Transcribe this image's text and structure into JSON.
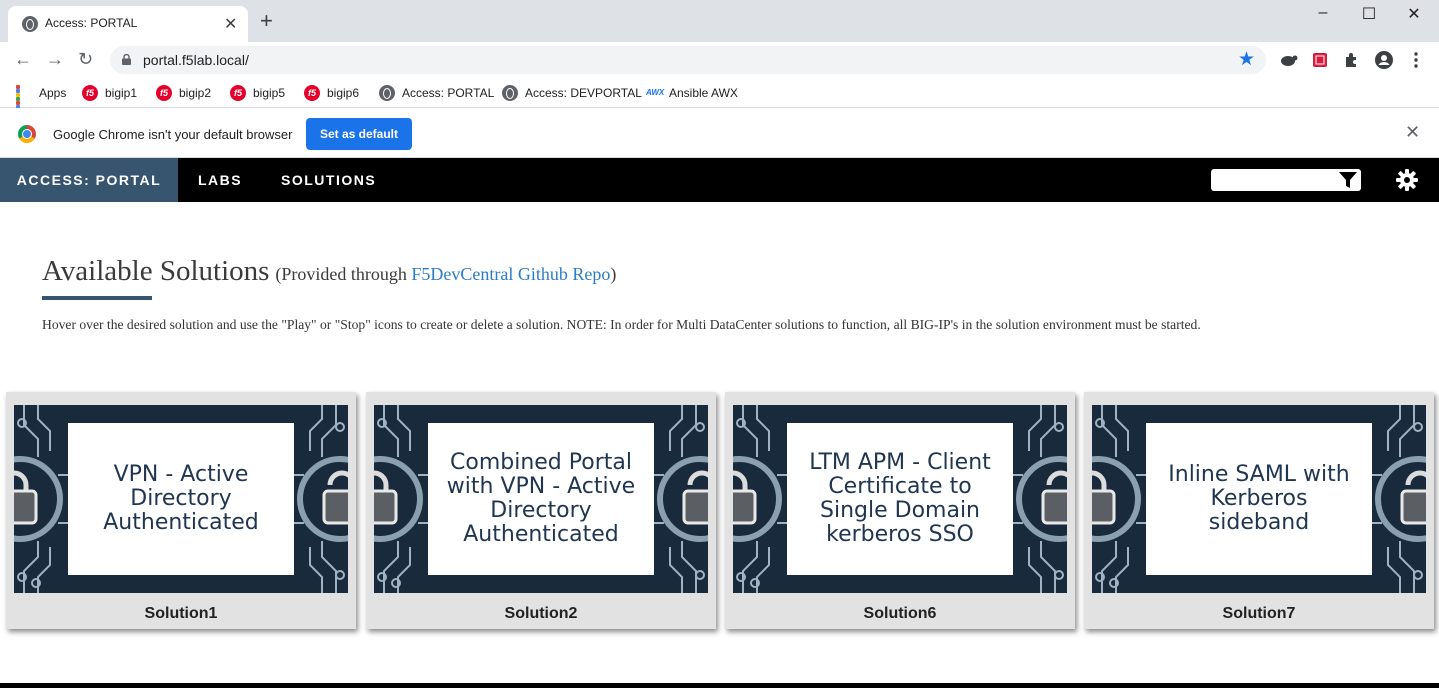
{
  "browser": {
    "tab_title": "Access: PORTAL",
    "url": "portal.f5lab.local/",
    "bookmarks": [
      {
        "label": "Apps",
        "icon": "apps-grid-icon"
      },
      {
        "label": "bigip1",
        "icon": "f5-logo-icon"
      },
      {
        "label": "bigip2",
        "icon": "f5-logo-icon"
      },
      {
        "label": "bigip5",
        "icon": "f5-logo-icon"
      },
      {
        "label": "bigip6",
        "icon": "f5-logo-icon"
      },
      {
        "label": "Access: PORTAL",
        "icon": "globe-icon"
      },
      {
        "label": "Access: DEVPORTAL",
        "icon": "globe-icon"
      },
      {
        "label": "Ansible AWX",
        "icon": "awx-icon"
      }
    ],
    "infobar": {
      "message": "Google Chrome isn't your default browser",
      "button_label": "Set as default"
    },
    "window_controls": {
      "minimize": "–",
      "maximize": "☐",
      "close": "✕"
    },
    "new_tab": "+",
    "tab_close": "✕",
    "infobar_close": "✕",
    "bookmark_star": "★",
    "accent_color": "#1a73e8"
  },
  "app": {
    "nav": {
      "brand": "ACCESS: PORTAL",
      "links": [
        "LABS",
        "SOLUTIONS"
      ],
      "search_placeholder": "",
      "brand_color": "#385570"
    },
    "page": {
      "heading": "Available Solutions",
      "subheading_prefix": "(Provided through ",
      "subheading_link": "F5DevCentral Github Repo",
      "subheading_suffix": ")",
      "instructions": "Hover over the desired solution and use the \"Play\" or \"Stop\" icons to create or delete a solution. NOTE: In order for Multi DataCenter solutions to function, all BIG-IP's in the solution environment must be started."
    },
    "solutions": [
      {
        "name": "Solution1",
        "image_text": "VPN - Active\nDirectory\nAuthenticated"
      },
      {
        "name": "Solution2",
        "image_text": "Combined Portal\nwith VPN - Active\nDirectory\nAuthenticated"
      },
      {
        "name": "Solution6",
        "image_text": "LTM APM - Client\nCertificate to\nSingle Domain\nkerberos SSO"
      },
      {
        "name": "Solution7",
        "image_text": "Inline SAML with\nKerberos\nsideband"
      }
    ]
  }
}
